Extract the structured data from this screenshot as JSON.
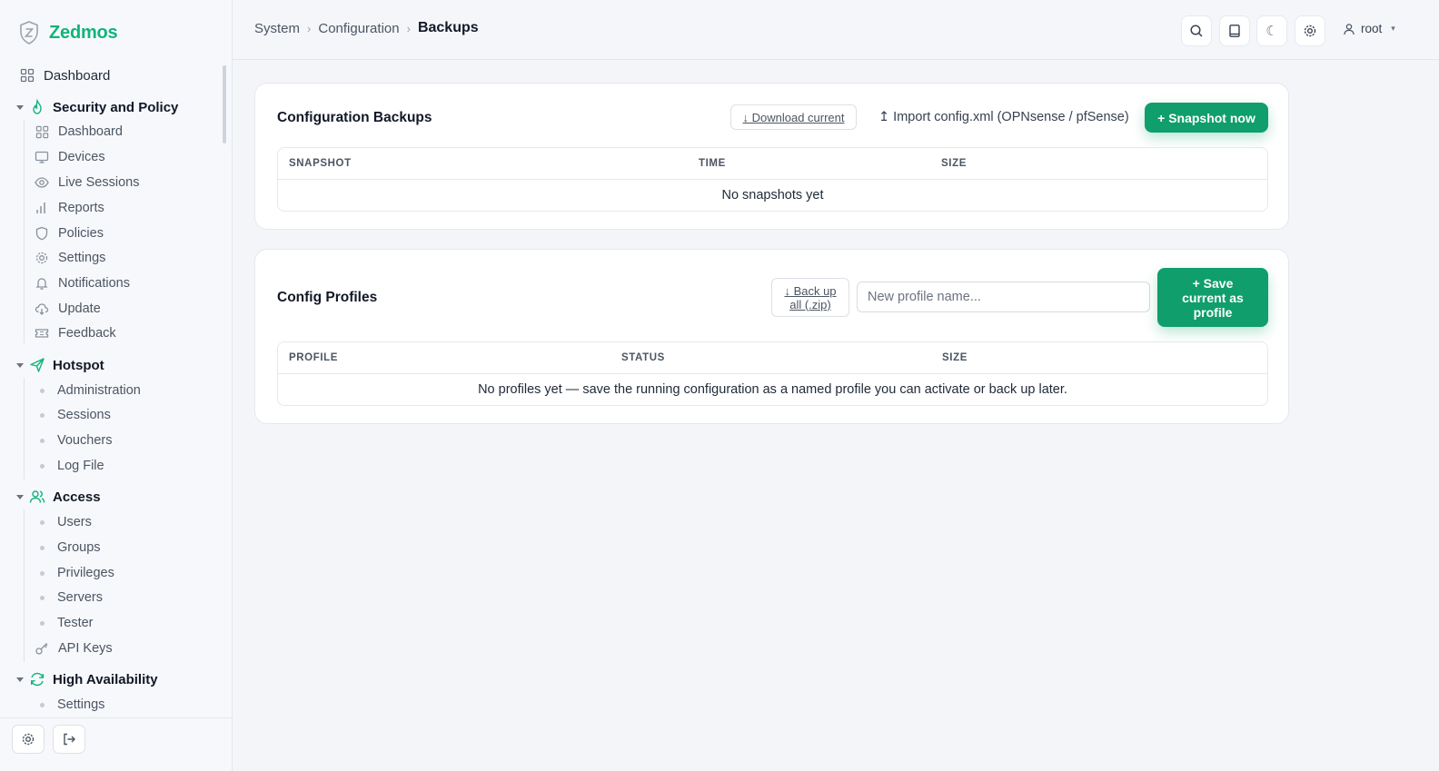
{
  "app": {
    "name": "Zedmos"
  },
  "breadcrumb": [
    "System",
    "Configuration",
    "Backups"
  ],
  "user": {
    "name": "root"
  },
  "sidebar": {
    "dashboard": "Dashboard",
    "sections": [
      {
        "title": "Security and Policy",
        "items": [
          "Dashboard",
          "Devices",
          "Live Sessions",
          "Reports",
          "Policies",
          "Settings",
          "Notifications",
          "Update",
          "Feedback"
        ]
      },
      {
        "title": "Hotspot",
        "items": [
          "Administration",
          "Sessions",
          "Vouchers",
          "Log File"
        ]
      },
      {
        "title": "Access",
        "items": [
          "Users",
          "Groups",
          "Privileges",
          "Servers",
          "Tester",
          "API Keys"
        ]
      },
      {
        "title": "High Availability",
        "items": [
          "Settings"
        ]
      }
    ]
  },
  "backups": {
    "title": "Configuration Backups",
    "download_label": "↓ Download current",
    "import_label": "↥ Import config.xml (OPNsense / pfSense)",
    "snapshot_label": "+ Snapshot now",
    "columns": [
      "SNAPSHOT",
      "TIME",
      "SIZE"
    ],
    "empty": "No snapshots yet"
  },
  "profiles": {
    "title": "Config Profiles",
    "backup_label": "↓ Back up all (.zip)",
    "input_placeholder": "New profile name...",
    "save_label": "+ Save current as profile",
    "columns": [
      "PROFILE",
      "STATUS",
      "SIZE"
    ],
    "empty": "No profiles yet — save the running configuration as a named profile you can activate or back up later."
  },
  "colors": {
    "accent": "#10b47a",
    "button": "#0f9e6c"
  }
}
